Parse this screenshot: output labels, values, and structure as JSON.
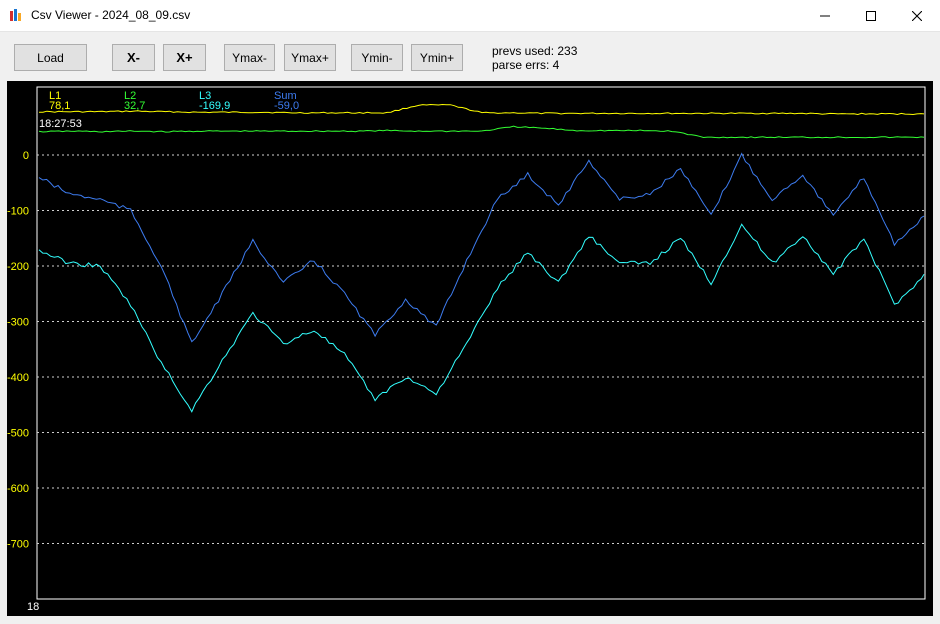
{
  "window": {
    "title": "Csv Viewer - 2024_08_09.csv",
    "icon": "bar-chart-icon",
    "controls": [
      "minimize-icon",
      "maximize-icon",
      "close-icon"
    ]
  },
  "toolbar": {
    "load": "Load",
    "x_minus": "X-",
    "x_plus": "X+",
    "ymax_minus": "Ymax-",
    "ymax_plus": "Ymax+",
    "ymin_minus": "Ymin-",
    "ymin_plus": "Ymin+"
  },
  "status": {
    "prevs_used": "prevs used: 233",
    "parse_errs": "parse errs: 4"
  },
  "legend": [
    {
      "name": "L1",
      "value": "78,1",
      "color": "#ffff00"
    },
    {
      "name": "L2",
      "value": "32,7",
      "color": "#33ff33"
    },
    {
      "name": "L3",
      "value": "-169,9",
      "color": "#33ffff"
    },
    {
      "name": "Sum",
      "value": "-59,0",
      "color": "#3d7cf0"
    }
  ],
  "cursor_time": "18:27:53",
  "x_start_label": "18",
  "chart_data": {
    "type": "line",
    "ylim": [
      -750,
      120
    ],
    "yticks": [
      0,
      -100,
      -200,
      -300,
      -400,
      -500,
      -600,
      -700
    ],
    "ytick_labels": [
      "0",
      "-100",
      "-200",
      "-300",
      "-400",
      "-500",
      "-600",
      "-700"
    ],
    "grid": true,
    "series": [
      {
        "name": "L1",
        "color": "#ffff00",
        "values": [
          78,
          78,
          78,
          79,
          78,
          77,
          77,
          77,
          76,
          76,
          76,
          76,
          90,
          90,
          76,
          76,
          75,
          75,
          75,
          75,
          75,
          75,
          75,
          75,
          75,
          74,
          74,
          74,
          74
        ]
      },
      {
        "name": "L2",
        "color": "#33ff33",
        "values": [
          42,
          43,
          42,
          43,
          42,
          43,
          43,
          43,
          43,
          43,
          43,
          44,
          43,
          43,
          43,
          51,
          48,
          44,
          44,
          44,
          43,
          32,
          32,
          32,
          32,
          32,
          32,
          32,
          32
        ]
      },
      {
        "name": "L3",
        "color": "#33ffff",
        "values": [
          -172,
          -195,
          -200,
          -270,
          -375,
          -460,
          -370,
          -285,
          -340,
          -315,
          -360,
          -440,
          -400,
          -430,
          -340,
          -240,
          -175,
          -230,
          -145,
          -195,
          -195,
          -150,
          -230,
          -125,
          -195,
          -145,
          -215,
          -150,
          -270,
          -215
        ]
      },
      {
        "name": "Sum",
        "color": "#3d7cf0",
        "values": [
          -40,
          -70,
          -80,
          -100,
          -200,
          -340,
          -250,
          -155,
          -230,
          -190,
          -250,
          -325,
          -260,
          -310,
          -190,
          -80,
          -35,
          -90,
          -10,
          -80,
          -70,
          -25,
          -110,
          0,
          -80,
          -35,
          -110,
          -40,
          -160,
          -110
        ]
      }
    ]
  }
}
